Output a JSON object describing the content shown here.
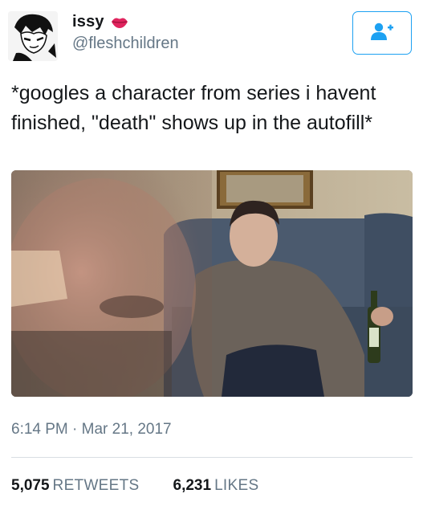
{
  "user": {
    "display_name": "issy",
    "handle": "@fleshchildren",
    "emoji_icon": "kiss-lips-icon"
  },
  "follow_button": {
    "icon": "follow-user-plus-icon",
    "accent": "#1da1f2"
  },
  "tweet": {
    "text": "*googles a character from series i havent finished, \"death\" shows up in the autofill*",
    "image_icon": "photo-man-on-couch"
  },
  "meta": {
    "time": "6:14 PM",
    "separator": "·",
    "date": "Mar 21, 2017"
  },
  "stats": {
    "retweets_count": "5,075",
    "retweets_label": "RETWEETS",
    "likes_count": "6,231",
    "likes_label": "LIKES"
  }
}
